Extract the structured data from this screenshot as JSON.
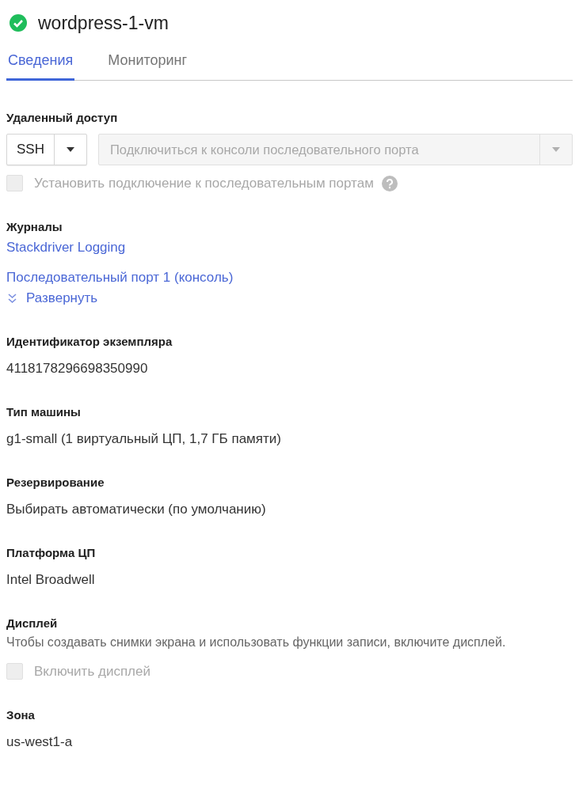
{
  "header": {
    "title": "wordpress-1-vm",
    "running": true
  },
  "tabs": [
    {
      "label": "Сведения",
      "selected": true
    },
    {
      "label": "Мониторинг",
      "selected": false
    }
  ],
  "sections": [
    {
      "kind": "remote",
      "heading": "Удаленный доступ",
      "ssh": "SSH",
      "console_placeholder": "Подключиться к консоли последовательного порта",
      "checkbox": {
        "label": "Установить подключение к последовательным портам",
        "checked": false,
        "disabled": true
      }
    },
    {
      "kind": "links",
      "heading": "Журналы",
      "links": [
        "Stackdriver Logging",
        "Последовательный порт 1 (консоль)"
      ],
      "expand": "Развернуть"
    },
    {
      "kind": "field",
      "heading": "Идентификатор экземпляра",
      "value": "4118178296698350990"
    },
    {
      "kind": "field",
      "heading": "Тип машины",
      "value": "g1-small (1 виртуальный ЦП, 1,7 ГБ памяти)"
    },
    {
      "kind": "field",
      "heading": "Резервирование",
      "value": "Выбирать автоматически (по умолчанию)"
    },
    {
      "kind": "field",
      "heading": "Платформа ЦП",
      "value": "Intel Broadwell"
    },
    {
      "kind": "display",
      "heading": "Дисплей",
      "description": "Чтобы создавать снимки экрана и использовать функции записи, включите дисплей.",
      "checkbox": {
        "label": "Включить дисплей",
        "checked": false,
        "disabled": true
      }
    },
    {
      "kind": "field",
      "heading": "Зона",
      "value": "us-west1-a"
    }
  ]
}
